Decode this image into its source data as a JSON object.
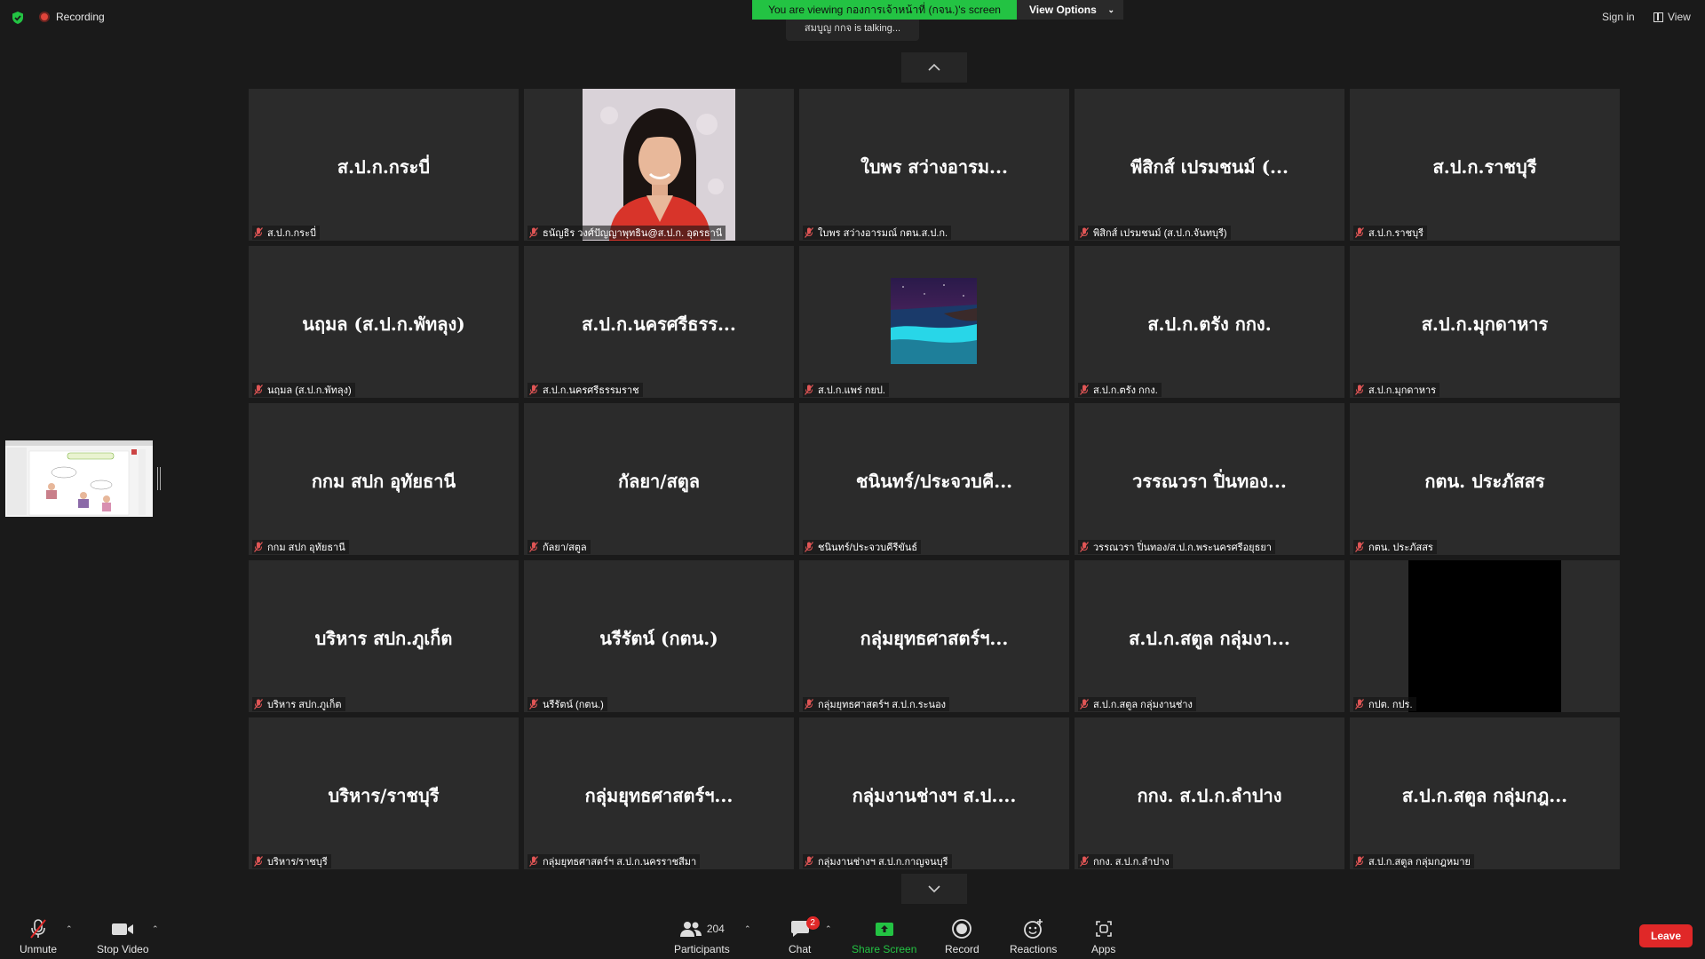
{
  "topbar": {
    "recording_label": "Recording",
    "viewing_banner": "You are viewing กองการเจ้าหน้าที่ (กจน.)'s screen",
    "view_options_label": "View Options",
    "talking_indicator": "สมบูญ กกจ is  talking...",
    "sign_in_label": "Sign in",
    "view_label": "View"
  },
  "tiles": [
    {
      "name": "ส.ป.ก.กระบี่",
      "label": "ส.ป.ก.กระบี่"
    },
    {
      "name": "",
      "label": "ธนัญธิร วงศ์ปัญญาพุทธิน@ส.ป.ก. อุดรธานี",
      "video": "photo"
    },
    {
      "name": "ใบพร สว่างอารม...",
      "label": "ใบพร สว่างอารมณ์ กตน.ส.ป.ก."
    },
    {
      "name": "พีสิกส์ เปรมชนม์ (...",
      "label": "พิสิกส์ เปรมชนม์ (ส.ป.ก.จันทบุรี)"
    },
    {
      "name": "ส.ป.ก.ราชบุรี",
      "label": "ส.ป.ก.ราชบุรี"
    },
    {
      "name": "นฤมล (ส.ป.ก.พัทลุง)",
      "label": "นฤมล (ส.ป.ก.พัทลุง)"
    },
    {
      "name": "ส.ป.ก.นครศรีธรร...",
      "label": "ส.ป.ก.นครศรีธรรมราช"
    },
    {
      "name": "",
      "label": "ส.ป.ก.แพร่ กยป.",
      "video": "beach"
    },
    {
      "name": "ส.ป.ก.ตรัง กกง.",
      "label": "ส.ป.ก.ตรัง กกง."
    },
    {
      "name": "ส.ป.ก.มุกดาหาร",
      "label": "ส.ป.ก.มุกดาหาร"
    },
    {
      "name": "กกม สปก อุทัยธานี",
      "label": "กกม สปก อุทัยธานี"
    },
    {
      "name": "กัลยา/สตูล",
      "label": "กัลยา/สตูล"
    },
    {
      "name": "ชนินทร์/ประจวบคี...",
      "label": "ชนินทร์/ประจวบคีรีขันธ์"
    },
    {
      "name": "วรรณวรา ปิ่นทอง...",
      "label": "วรรณวรา ปิ่นทอง/ส.ป.ก.พระนครศรีอยุธยา"
    },
    {
      "name": "กตน. ประภัสสร",
      "label": "กตน. ประภัสสร"
    },
    {
      "name": "บริหาร สปก.ภูเก็ต",
      "label": "บริหาร สปก.ภูเก็ต"
    },
    {
      "name": "นรีรัตน์ (กตน.)",
      "label": "นรีรัตน์ (กตน.)"
    },
    {
      "name": "กลุ่มยุทธศาสตร์ฯ...",
      "label": "กลุ่มยุทธศาสตร์ฯ ส.ป.ก.ระนอง"
    },
    {
      "name": "ส.ป.ก.สตูล กลุ่มงา...",
      "label": "ส.ป.ก.สตูล กลุ่มงานช่าง"
    },
    {
      "name": "",
      "label": "กปต. กปร.",
      "video": "black"
    },
    {
      "name": "บริหาร/ราชบุรี",
      "label": "บริหาร/ราชบุรี"
    },
    {
      "name": "กลุ่มยุทธศาสตร์ฯ...",
      "label": "กลุ่มยุทธศาสตร์ฯ ส.ป.ก.นครราชสีมา"
    },
    {
      "name": "กลุ่มงานช่างฯ ส.ป....",
      "label": "กลุ่มงานช่างฯ ส.ป.ก.กาญจนบุรี"
    },
    {
      "name": "กกง. ส.ป.ก.ลำปาง",
      "label": "กกง. ส.ป.ก.ลำปาง"
    },
    {
      "name": "ส.ป.ก.สตูล กลุ่มกฎ...",
      "label": "ส.ป.ก.สตูล กลุ่มกฎหมาย"
    }
  ],
  "toolbar": {
    "unmute_label": "Unmute",
    "stop_video_label": "Stop Video",
    "participants_label": "Participants",
    "participants_count": "204",
    "chat_label": "Chat",
    "chat_badge": "2",
    "share_screen_label": "Share Screen",
    "record_label": "Record",
    "reactions_label": "Reactions",
    "apps_label": "Apps",
    "leave_label": "Leave"
  },
  "colors": {
    "share_green": "#23c343",
    "leave_red": "#e02828",
    "tile_bg": "#2b2b2b"
  }
}
